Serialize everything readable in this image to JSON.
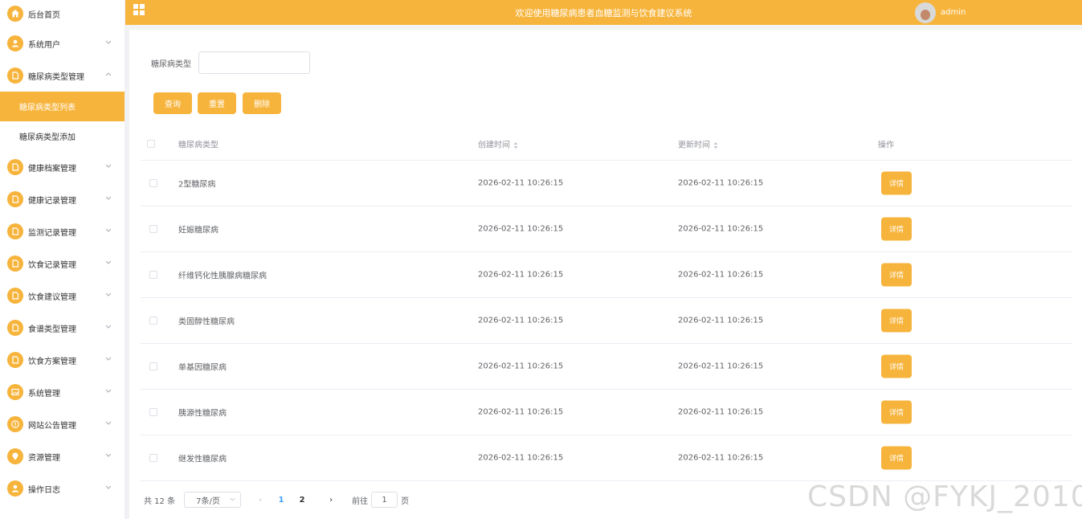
{
  "header": {
    "title": "欢迎使用糖尿病患者血糖监测与饮食建议系统",
    "username": "admin"
  },
  "sidebar": {
    "items": [
      {
        "label": "后台首页",
        "icon": "home-icon"
      },
      {
        "label": "系统用户",
        "icon": "user-icon"
      },
      {
        "label": "糖尿病类型管理",
        "icon": "document-icon",
        "expanded": true
      },
      {
        "label": "健康档案管理",
        "icon": "document-icon"
      },
      {
        "label": "健康记录管理",
        "icon": "document-icon"
      },
      {
        "label": "监测记录管理",
        "icon": "document-icon"
      },
      {
        "label": "饮食记录管理",
        "icon": "document-icon"
      },
      {
        "label": "饮食建议管理",
        "icon": "document-icon"
      },
      {
        "label": "食谱类型管理",
        "icon": "document-icon"
      },
      {
        "label": "饮食方案管理",
        "icon": "document-icon"
      },
      {
        "label": "系统管理",
        "icon": "image-icon"
      },
      {
        "label": "网站公告管理",
        "icon": "info-icon"
      },
      {
        "label": "资源管理",
        "icon": "location-icon"
      },
      {
        "label": "操作日志",
        "icon": "user-icon"
      }
    ],
    "submenu": [
      {
        "label": "糖尿病类型列表",
        "active": true
      },
      {
        "label": "糖尿病类型添加",
        "active": false
      }
    ]
  },
  "search": {
    "label": "糖尿病类型",
    "value": "",
    "query_label": "查询",
    "reset_label": "重置",
    "delete_label": "删除"
  },
  "table": {
    "columns": [
      "糖尿病类型",
      "创建时间",
      "更新时间",
      "操作"
    ],
    "rows": [
      {
        "type": "2型糖尿病",
        "created": "2026-02-11 10:26:15",
        "updated": "2026-02-11 10:26:15",
        "action": "详情"
      },
      {
        "type": "妊娠糖尿病",
        "created": "2026-02-11 10:26:15",
        "updated": "2026-02-11 10:26:15",
        "action": "详情"
      },
      {
        "type": "纤维钙化性胰腺病糖尿病",
        "created": "2026-02-11 10:26:15",
        "updated": "2026-02-11 10:26:15",
        "action": "详情"
      },
      {
        "type": "类固醇性糖尿病",
        "created": "2026-02-11 10:26:15",
        "updated": "2026-02-11 10:26:15",
        "action": "详情"
      },
      {
        "type": "单基因糖尿病",
        "created": "2026-02-11 10:26:15",
        "updated": "2026-02-11 10:26:15",
        "action": "详情"
      },
      {
        "type": "胰源性糖尿病",
        "created": "2026-02-11 10:26:15",
        "updated": "2026-02-11 10:26:15",
        "action": "详情"
      },
      {
        "type": "继发性糖尿病",
        "created": "2026-02-11 10:26:15",
        "updated": "2026-02-11 10:26:15",
        "action": "详情"
      }
    ]
  },
  "pagination": {
    "total": "共 12 条",
    "page_size": "7条/页",
    "pages": [
      "1",
      "2"
    ],
    "current": "1",
    "goto_prefix": "前往",
    "goto_value": "1",
    "goto_suffix": "页"
  },
  "watermark": "CSDN @FYKJ_2010",
  "colors": {
    "accent": "#f7b43c",
    "active_page": "#409eff"
  }
}
